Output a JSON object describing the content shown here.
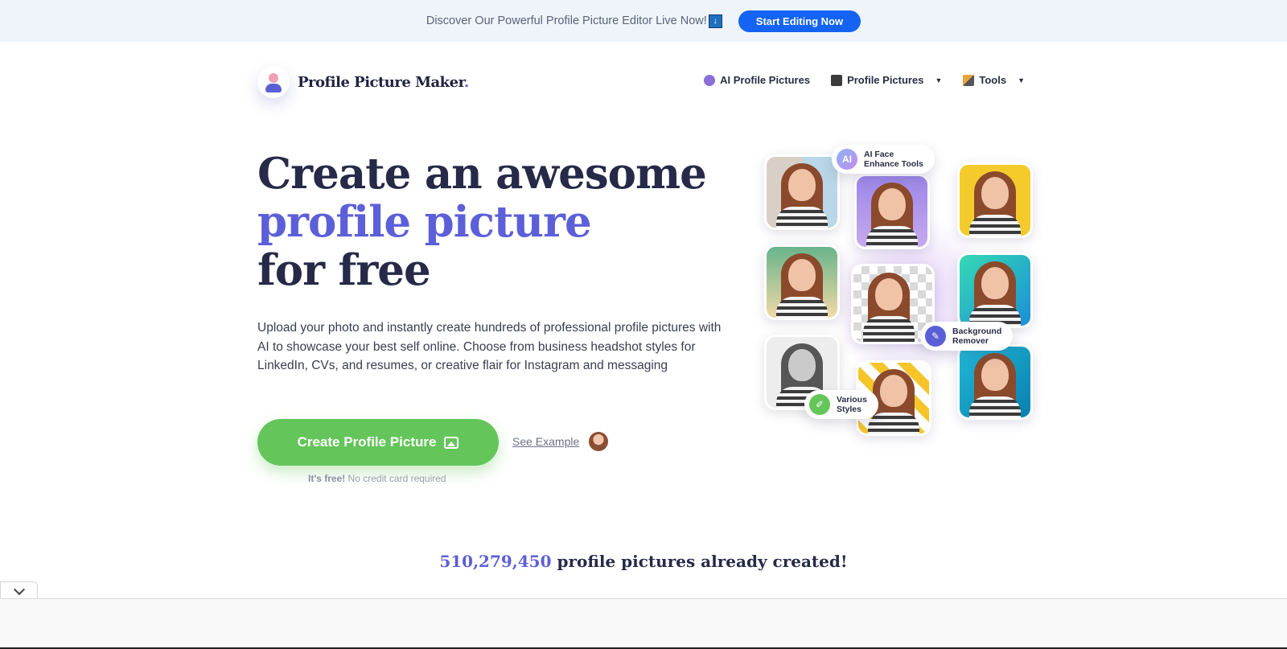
{
  "announcement": {
    "text": "Discover Our Powerful Profile Picture Editor Live Now!",
    "icon": "download-arrow-icon",
    "button_label": "Start Editing Now"
  },
  "brand": {
    "name": "Profile Picture Maker",
    "suffix": "."
  },
  "nav": [
    {
      "label": "AI Profile Pictures",
      "icon": "brain-icon",
      "has_dropdown": false
    },
    {
      "label": "Profile Pictures",
      "icon": "folder-icon",
      "has_dropdown": true
    },
    {
      "label": "Tools",
      "icon": "tools-icon",
      "has_dropdown": true
    }
  ],
  "hero": {
    "title_line1": "Create an awesome",
    "title_accent": "profile picture",
    "title_line3": "for free",
    "description": "Upload your photo and instantly create hundreds of professional profile pictures with AI to showcase your best self online. Choose from business headshot styles for LinkedIn, CVs, and resumes, or creative flair for Instagram and messaging",
    "cta_label": "Create Profile Picture",
    "see_example": "See Example",
    "free_bold": "It's free!",
    "free_rest": "No credit card required"
  },
  "badges": {
    "ai_line1": "AI Face",
    "ai_line2": "Enhance Tools",
    "ai_icon_text": "AI",
    "bg_line1": "Background",
    "bg_line2": "Remover",
    "styles_line1": "Various",
    "styles_line2": "Styles"
  },
  "stats": {
    "count": "510,279,450",
    "text": "profile pictures already created!"
  },
  "colors": {
    "accent": "#5d5fd8",
    "cta_green": "#64c55a",
    "announcement_button": "#1463f3",
    "heading": "#262a48"
  }
}
